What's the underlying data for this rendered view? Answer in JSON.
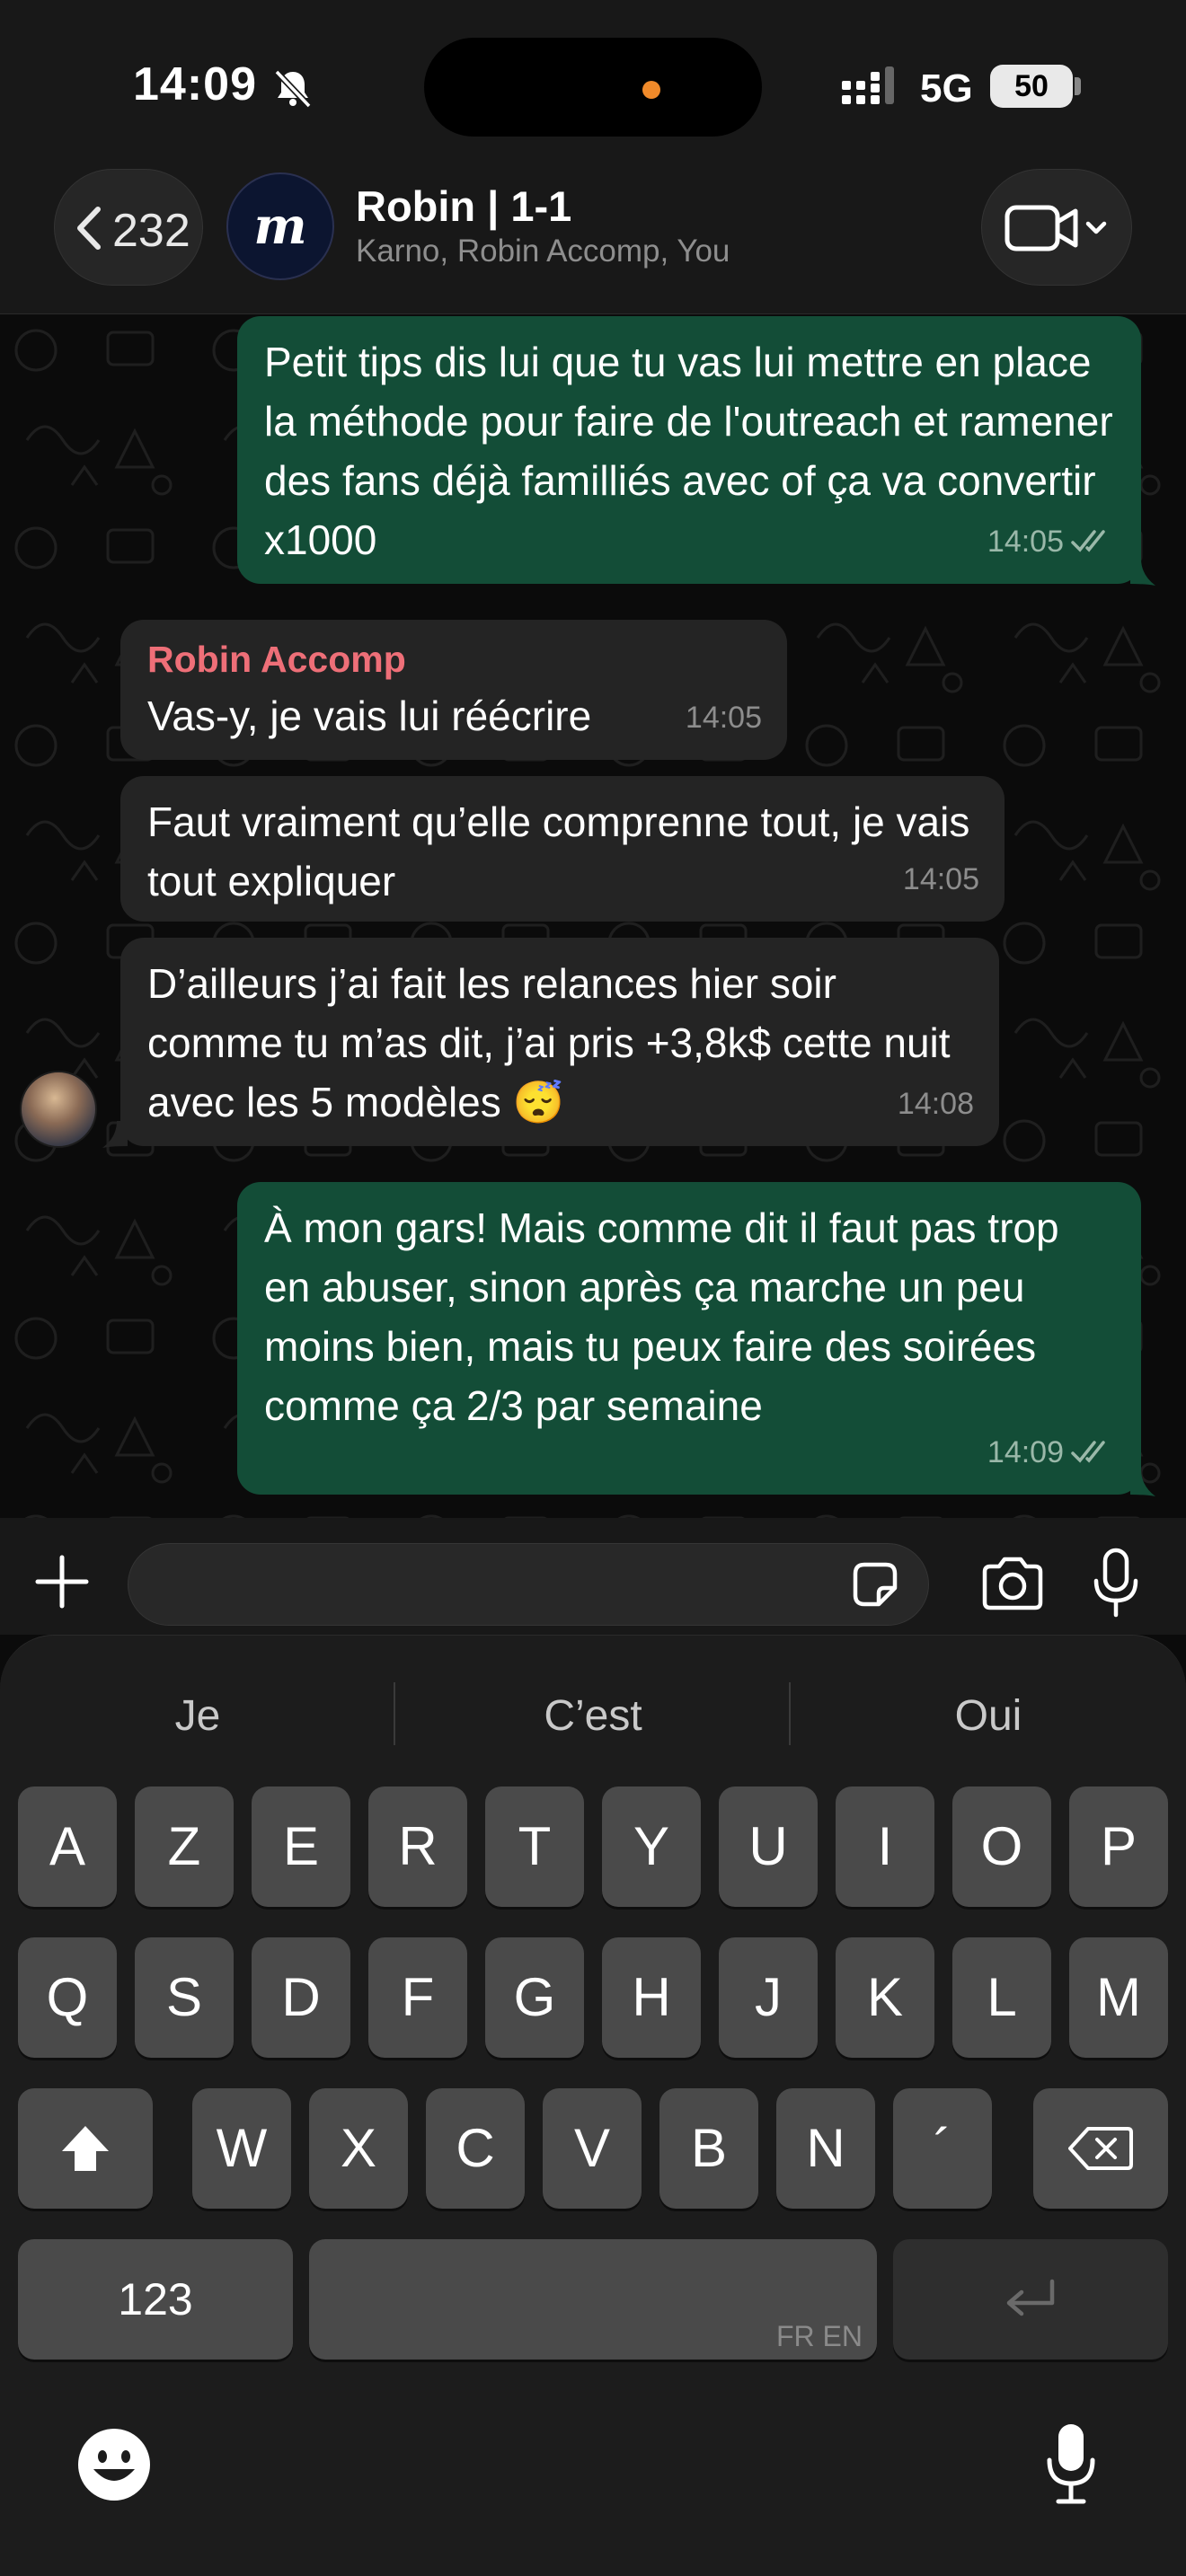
{
  "status_bar": {
    "time": "14:09",
    "network": "5G",
    "battery": "50"
  },
  "header": {
    "back_count": "232",
    "avatar_letter": "m",
    "title": "Robin | 1-1",
    "members": "Karno, Robin Accomp, You"
  },
  "messages": [
    {
      "direction": "outgoing",
      "text": "Petit tips dis lui que tu vas lui mettre en place la méthode pour faire de l'outreach et ramener des fans déjà familliés avec of ça va convertir x1000",
      "time": "14:05",
      "read": true
    },
    {
      "direction": "incoming",
      "sender": "Robin Accomp",
      "text": "Vas-y, je vais lui réécrire",
      "time": "14:05"
    },
    {
      "direction": "incoming",
      "text": "Faut vraiment qu’elle comprenne tout, je vais tout expliquer",
      "time": "14:05"
    },
    {
      "direction": "incoming",
      "text": "D’ailleurs j’ai fait les relances hier soir comme tu m’as dit, j’ai pris +3,8k$ cette nuit avec les 5 modèles 😴",
      "time": "14:08"
    },
    {
      "direction": "outgoing",
      "text": "À mon gars! Mais comme dit il faut pas trop en abuser, sinon après ça marche un peu moins bien, mais tu peux faire des soirées comme ça 2/3 par semaine",
      "time": "14:09",
      "read": true
    }
  ],
  "input": {
    "value": "",
    "placeholder": ""
  },
  "keyboard": {
    "suggestions": [
      "Je",
      "C’est",
      "Oui"
    ],
    "row1": [
      "A",
      "Z",
      "E",
      "R",
      "T",
      "Y",
      "U",
      "I",
      "O",
      "P"
    ],
    "row2": [
      "Q",
      "S",
      "D",
      "F",
      "G",
      "H",
      "J",
      "K",
      "L",
      "M"
    ],
    "row3": [
      "W",
      "X",
      "C",
      "V",
      "B",
      "N",
      "´"
    ],
    "numbers_label": "123",
    "space_language": "FR EN"
  },
  "colors": {
    "outgoing_bubble": "#134d37",
    "incoming_bubble": "#242424",
    "sender_name": "#ee6f78",
    "background": "#0b0b0b"
  },
  "icons": [
    "bell-slash-icon",
    "signal-icon",
    "chevron-left-icon",
    "video-camera-icon",
    "chevron-down-icon",
    "plus-icon",
    "sticker-icon",
    "camera-icon",
    "microphone-icon",
    "double-check-icon",
    "shift-icon",
    "backspace-icon",
    "return-icon",
    "emoji-icon"
  ]
}
